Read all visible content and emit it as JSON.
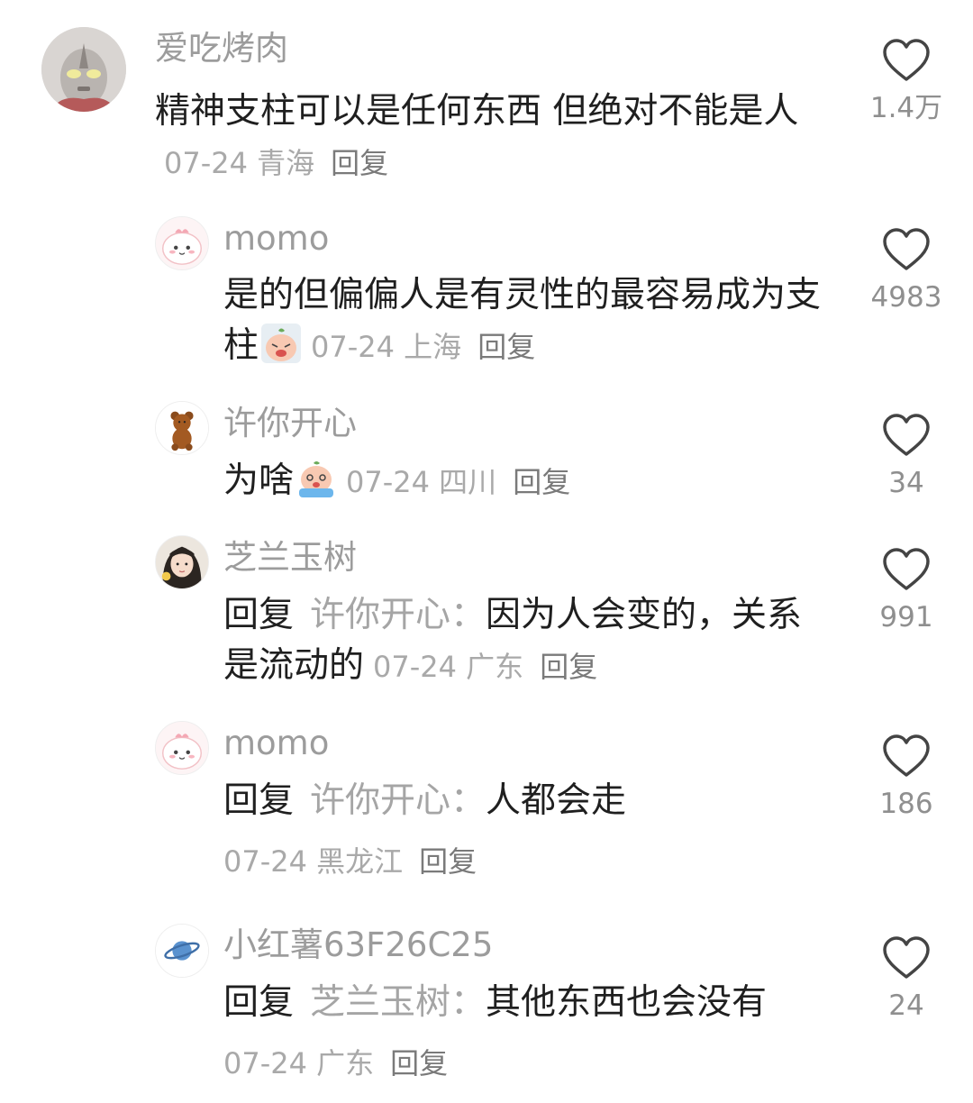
{
  "comments": [
    {
      "username": "爱吃烤肉",
      "text": "精神支柱可以是任何东西 但绝对不能是人",
      "date": "07-24",
      "location": "青海",
      "reply_label": "回复",
      "likes": "1.4万",
      "avatar_icon": "ultraman-avatar-icon"
    },
    {
      "username": "momo",
      "text": "是的但偏偏人是有灵性的最容易成为支柱",
      "emoji": "crying-peach-emoji",
      "date": "07-24",
      "location": "上海",
      "reply_label": "回复",
      "likes": "4983",
      "avatar_icon": "pink-dino-avatar-icon"
    },
    {
      "username": "许你开心",
      "text": "为啥",
      "emoji": "sobbing-peach-emoji",
      "date": "07-24",
      "location": "四川",
      "reply_label": "回复",
      "likes": "34",
      "avatar_icon": "teddy-bear-avatar-icon"
    },
    {
      "username": "芝兰玉树",
      "reply_prefix": "回复",
      "reply_target": "许你开心：",
      "text": "因为人会变的，关系是流动的",
      "date": "07-24",
      "location": "广东",
      "reply_label": "回复",
      "likes": "991",
      "avatar_icon": "girl-photo-avatar-icon"
    },
    {
      "username": "momo",
      "reply_prefix": "回复",
      "reply_target": "许你开心：",
      "text": "人都会走",
      "date": "07-24",
      "location": "黑龙江",
      "reply_label": "回复",
      "likes": "186",
      "avatar_icon": "pink-dino-avatar-icon"
    },
    {
      "username": "小红薯63F26C25",
      "reply_prefix": "回复",
      "reply_target": "芝兰玉树：",
      "text": "其他东西也会没有",
      "date": "07-24",
      "location": "广东",
      "reply_label": "回复",
      "likes": "24",
      "avatar_icon": "planet-avatar-icon"
    }
  ]
}
